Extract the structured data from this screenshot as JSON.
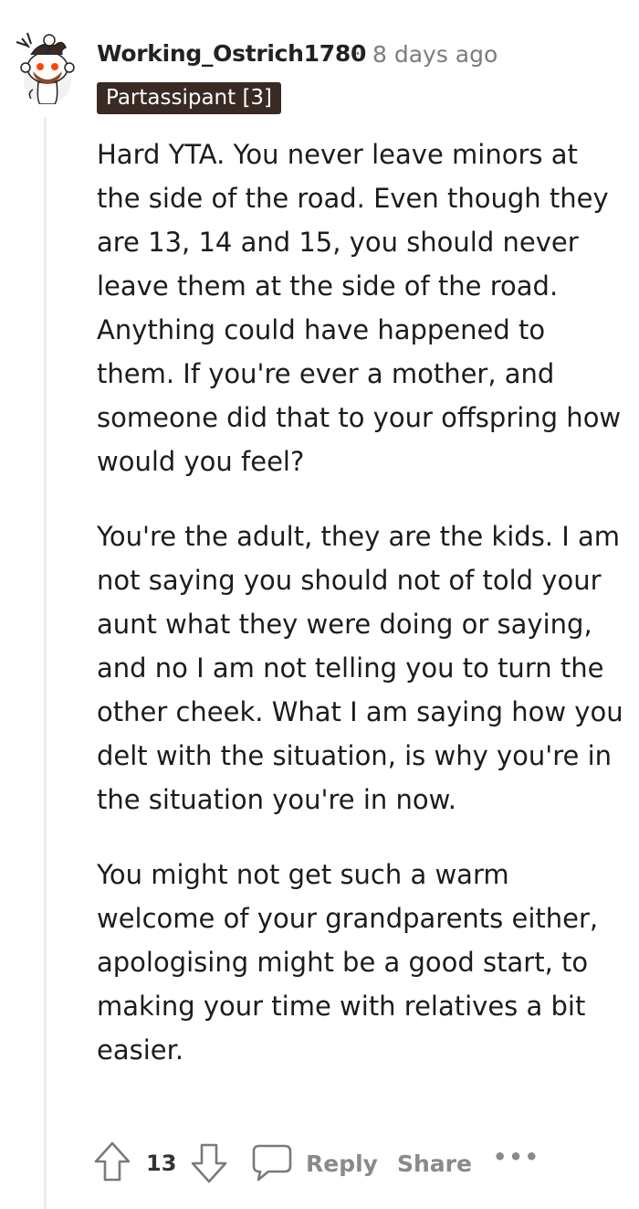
{
  "comment": {
    "username": "Working_Ostrich1780",
    "separator": "·",
    "timestamp": "8 days ago",
    "flair": "Partassipant [3]",
    "paragraphs": [
      "Hard YTA. You never leave minors at the side of the road. Even though they are 13, 14 and 15, you should never leave them at the side of the road. Anything could have happened to them. If you're ever a mother, and someone did that to your offspring how would you feel?",
      "You're the adult, they are the kids. I am not saying you should not of told your aunt what they were doing or saying, and no I am not telling you to turn the other cheek. What I am saying how you delt with the situation, is why you're in the situation you're in now.",
      "You might not get such a warm welcome of your grandparents either, apologising might be a good start, to making your time with relatives a bit easier."
    ]
  },
  "actions": {
    "vote_count": "13",
    "reply_label": "Reply",
    "share_label": "Share",
    "more_label": "•••"
  },
  "icons": {
    "upvote": "arrow-up-icon",
    "downvote": "arrow-down-icon",
    "reply": "speech-bubble-icon",
    "more": "more-options-icon"
  },
  "colors": {
    "flair_bg": "#3a2a24",
    "muted": "#7c7c7c",
    "text": "#1c1c1c",
    "thread_line": "#ececec"
  }
}
